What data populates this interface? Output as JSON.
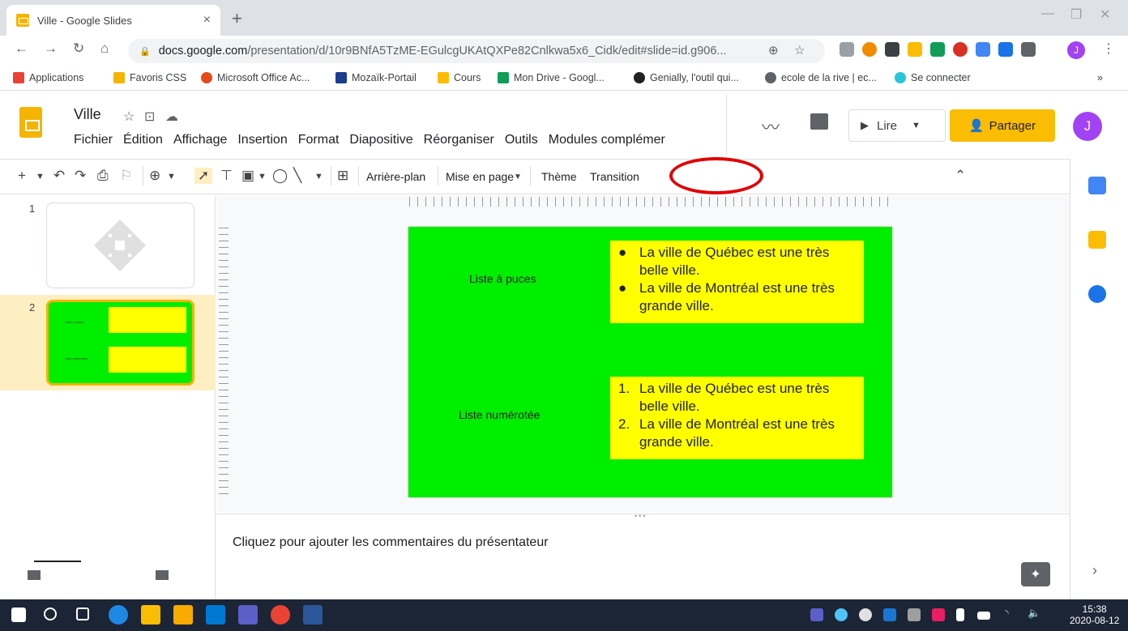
{
  "browser": {
    "tab_title": "Ville - Google Slides",
    "tab_close": "×",
    "new_tab": "+",
    "url_host": "docs.google.com",
    "url_path": "/presentation/d/10r9BNfA5TzME-EGulcgUKAtQXPe82Cnlkwa5x6_Cidk/edit#slide=id.g906...",
    "profile_initial": "J",
    "bookmarks": [
      "Applications",
      "Favoris CSS",
      "Microsoft Office Ac...",
      "Mozaïk-Portail",
      "Cours",
      "Mon Drive - Googl...",
      "Genially, l'outil qui...",
      "ecole de la rive | ec...",
      "Se connecter"
    ],
    "bookmarks_more": "»"
  },
  "app": {
    "doc_title": "Ville",
    "menu": [
      "Fichier",
      "Édition",
      "Affichage",
      "Insertion",
      "Format",
      "Diapositive",
      "Réorganiser",
      "Outils",
      "Modules complémer"
    ],
    "present_label": "Lire",
    "share_label": "Partager",
    "avatar_initial": "J",
    "colors": {
      "accent": "#fbbc04",
      "slides_yellow": "#f4b400",
      "annotation_red": "#e00000"
    }
  },
  "toolbar": {
    "background_label": "Arrière-plan",
    "layout_label": "Mise en page",
    "theme_label": "Thème",
    "transition_label": "Transition"
  },
  "filmstrip": {
    "slide_numbers": [
      "1",
      "2"
    ]
  },
  "slide": {
    "background": "#00ee00",
    "box_color": "#ffff00",
    "label_bullets": "Liste à puces",
    "label_numbered": "Liste numérotée",
    "bullet_markers": [
      "●",
      "●"
    ],
    "numbered_markers": [
      "1.",
      "2."
    ],
    "items": [
      "La ville de Québec est une très belle ville.",
      "La ville de Montréal est une très grande ville."
    ]
  },
  "notes": {
    "placeholder": "Cliquez pour ajouter les commentaires du présentateur"
  },
  "taskbar": {
    "time": "15:38",
    "date": "2020-08-12"
  }
}
